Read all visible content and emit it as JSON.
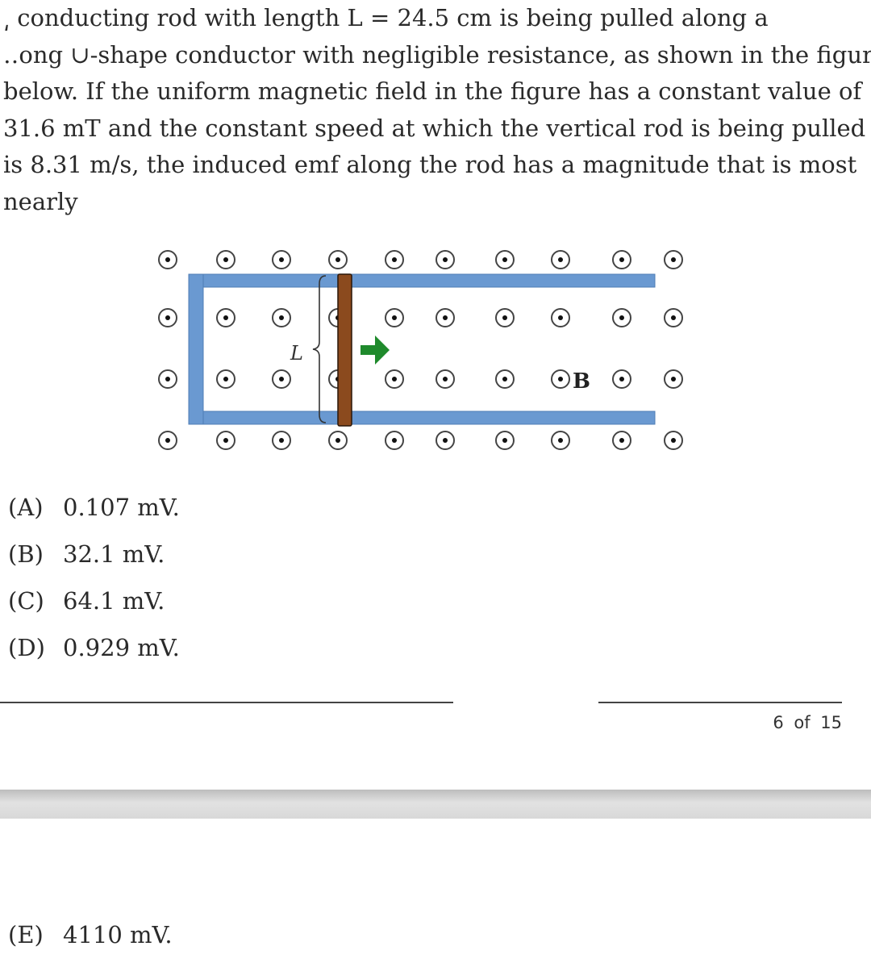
{
  "question": {
    "lines": [
      "͵ conducting rod with length L = 24.5 cm is being pulled along a",
      "․․ong ∪-shape conductor with negligible resistance, as shown in the figure",
      "below. If the uniform magnetic field in the figure has a constant value of",
      "31.6 mT and the constant speed at which the vertical rod is being pulled",
      "is 8.31 m/s, the induced emf along the rod has a magnitude that is most",
      "nearly"
    ]
  },
  "figure": {
    "length_label": "L",
    "field_label": "B",
    "field_symbol": "dot-in-circle (field out of page)",
    "rod_color": "#8b4a1e",
    "rail_color": "#6a99d1",
    "arrow_color": "#1f8a2c",
    "arrow_direction": "right"
  },
  "choices": [
    {
      "label": "(A)",
      "value": "0.107 mV."
    },
    {
      "label": "(B)",
      "value": "32.1 mV."
    },
    {
      "label": "(C)",
      "value": "64.1 mV."
    },
    {
      "label": "(D)",
      "value": "0.929 mV."
    },
    {
      "label": "(E)",
      "value": "4110 mV."
    }
  ],
  "footer": {
    "page_indicator": "6 of 15"
  }
}
